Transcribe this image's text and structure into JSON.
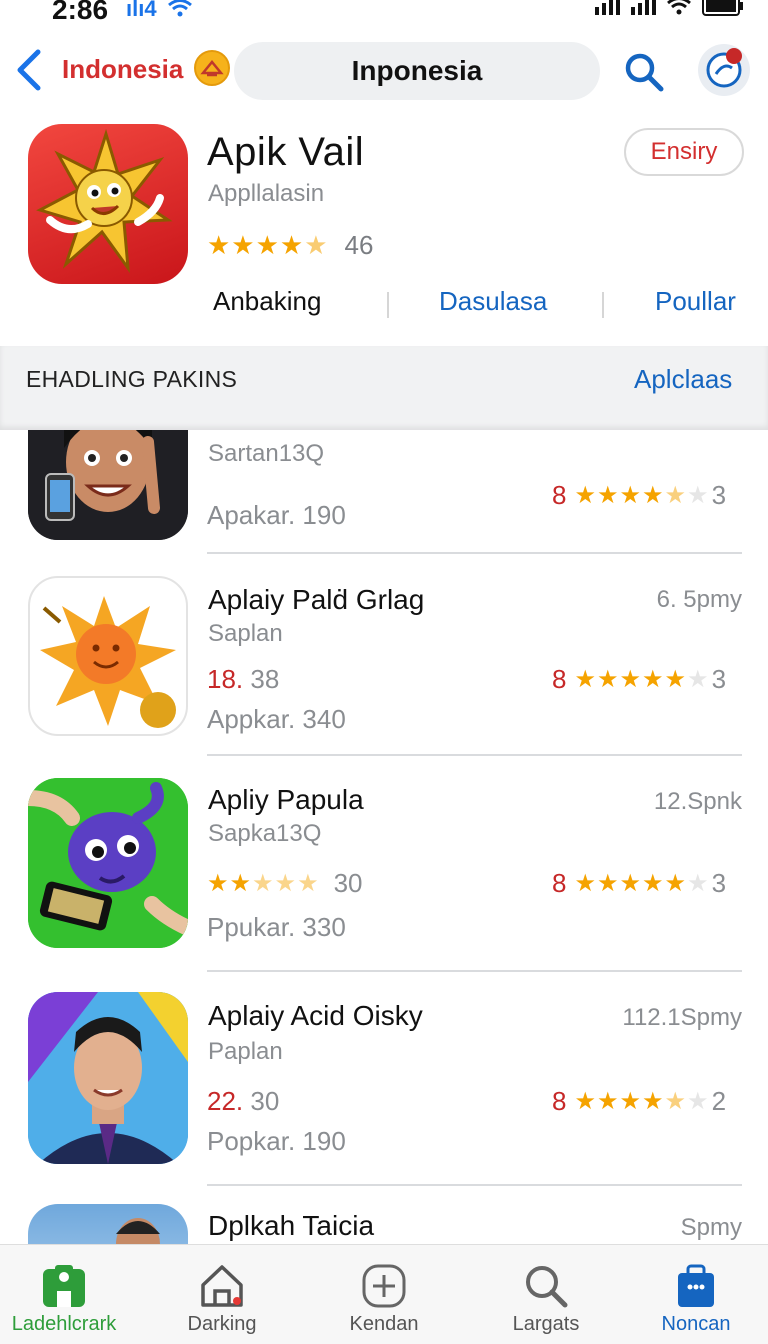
{
  "status_bar": {
    "time": "2:86",
    "network": "4"
  },
  "nav": {
    "country": "Indonesia",
    "search_text": "Inponesia"
  },
  "app": {
    "title": "Apik Vail",
    "subtitle": "Appllalasin",
    "rating_count": "46",
    "rating_stars": 4.5,
    "get_label": "Ensiry",
    "tabs": [
      "Anbaking",
      "Dasulasa",
      "Poullar"
    ]
  },
  "section": {
    "title": "EHADLING PAKINS",
    "link": "Aplclaas"
  },
  "list": [
    {
      "title": "",
      "size": "",
      "sub": "Sartan13Q",
      "price_red": "",
      "price_rest": "",
      "left_rating": null,
      "meta": "Apakar. 190",
      "rating_num": "8",
      "rating_tail": "3",
      "stars": 4.5
    },
    {
      "title": "Aplaiy Palḋ Grlag",
      "size": "6. 5pmy",
      "sub": "Saplan",
      "price_red": "18.",
      "price_rest": " 38",
      "left_rating": null,
      "meta": "Appkar. 340",
      "rating_num": "8",
      "rating_tail": "3",
      "stars": 4.5
    },
    {
      "title": "Apliy Papula",
      "size": "12.Spnk",
      "sub": "Sapka13Q",
      "price_red": "",
      "price_rest": "",
      "left_rating": {
        "count": "30",
        "stars": 2.5
      },
      "meta": "Ppukar. 330",
      "rating_num": "8",
      "rating_tail": "3",
      "stars": 4.5
    },
    {
      "title": "Aplaiy Acid Oisky",
      "size": "112.1Spmy",
      "sub": "Paplan",
      "price_red": "22.",
      "price_rest": " 30",
      "left_rating": null,
      "meta": "Popkar. 190",
      "rating_num": "8",
      "rating_tail": "2",
      "stars": 4.5
    },
    {
      "title": "Dplkah Taicia",
      "size": "Spmy",
      "sub": "",
      "price_red": "",
      "price_rest": "",
      "left_rating": null,
      "meta": "",
      "rating_num": "",
      "rating_tail": "",
      "stars": 0
    }
  ],
  "tabbar": [
    {
      "label": "Ladehlcrark",
      "icon": "today-icon",
      "active": true
    },
    {
      "label": "Darking",
      "icon": "home-icon",
      "active": false
    },
    {
      "label": "Kendan",
      "icon": "plus-icon",
      "active": false
    },
    {
      "label": "Largats",
      "icon": "search-icon",
      "active": false
    },
    {
      "label": "Noncan",
      "icon": "briefcase-icon",
      "active": true
    }
  ],
  "colors": {
    "accent_blue": "#1565c0",
    "accent_red": "#d32f2f",
    "star": "#f5a300",
    "green": "#2e9d3a"
  }
}
